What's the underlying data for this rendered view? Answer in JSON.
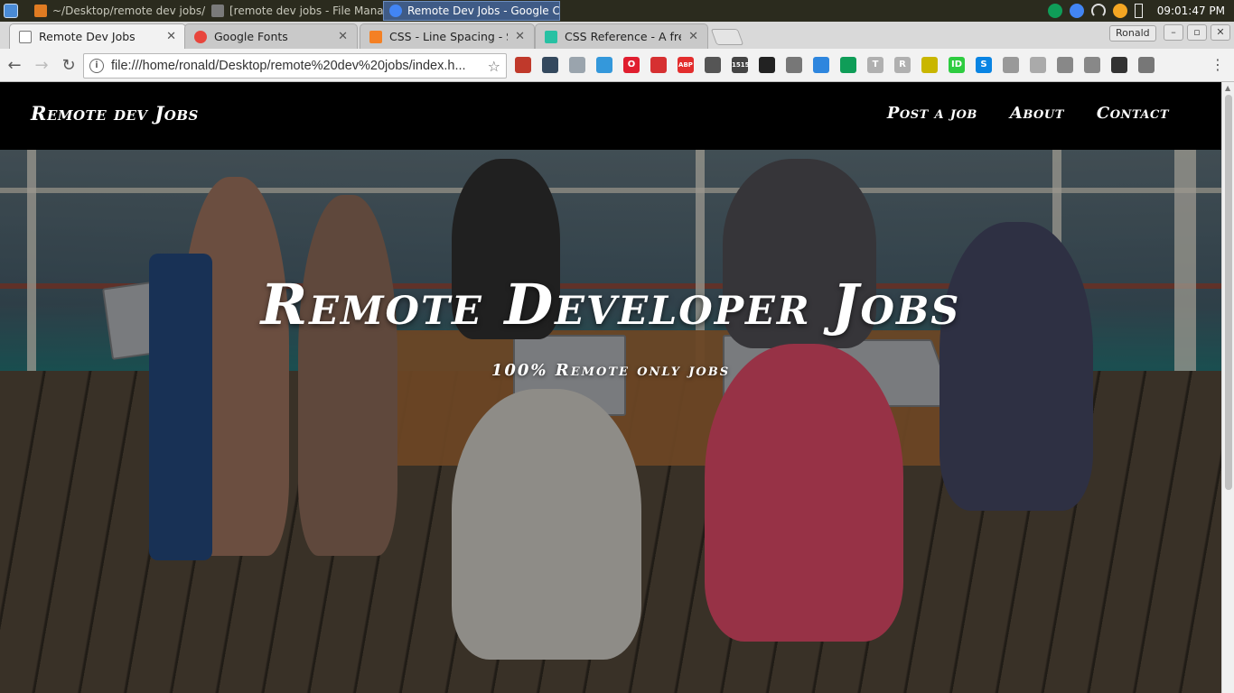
{
  "taskbar": {
    "tasks": [
      {
        "label": "~/Desktop/remote dev jobs/i...",
        "color": "#e07b22"
      },
      {
        "label": "[remote dev jobs - File Mana...",
        "color": "#7a7a7a"
      },
      {
        "label": "Remote Dev Jobs - Google C...",
        "color": "#4285f4"
      }
    ],
    "clock": "09:01:47 PM"
  },
  "browser": {
    "tabs": [
      {
        "title": "Remote Dev Jobs",
        "favicon": "document-icon",
        "color": "#777777"
      },
      {
        "title": "Google Fonts",
        "favicon": "google-fonts-icon",
        "color": "#e8453c"
      },
      {
        "title": "CSS - Line Spacing - Stac",
        "favicon": "stackoverflow-icon",
        "color": "#f48024"
      },
      {
        "title": "CSS Reference - A free v",
        "favicon": "codrops-icon",
        "color": "#27c1a3"
      }
    ],
    "profile": "Ronald",
    "url": "file:///home/ronald/Desktop/remote%20dev%20jobs/index.h...",
    "extensions": [
      {
        "name": "bookmark-icon",
        "color": "#c0392b",
        "text": ""
      },
      {
        "name": "cloud-icon",
        "color": "#34495e",
        "text": ""
      },
      {
        "name": "mail-icon",
        "color": "#9aa4ad",
        "text": ""
      },
      {
        "name": "download-icon",
        "color": "#3498db",
        "text": ""
      },
      {
        "name": "opera-icon",
        "color": "#e01e2f",
        "text": "O"
      },
      {
        "name": "stopwatch-icon",
        "color": "#d63031",
        "text": ""
      },
      {
        "name": "adblock-icon",
        "color": "#e32d2d",
        "text": "ABP"
      },
      {
        "name": "steering-icon",
        "color": "#555555",
        "text": ""
      },
      {
        "name": "days-counter-icon",
        "color": "#444444",
        "text": "1515"
      },
      {
        "name": "tampermonkey-icon",
        "color": "#222222",
        "text": ""
      },
      {
        "name": "paperclip-icon",
        "color": "#777777",
        "text": ""
      },
      {
        "name": "pulse-icon",
        "color": "#2e86de",
        "text": ""
      },
      {
        "name": "chat-icon",
        "color": "#0f9d58",
        "text": ""
      },
      {
        "name": "text-icon",
        "color": "#b0b0b0",
        "text": "T"
      },
      {
        "name": "readability-icon",
        "color": "#b0b0b0",
        "text": "R"
      },
      {
        "name": "light-icon",
        "color": "#c9b600",
        "text": ""
      },
      {
        "name": "id-icon",
        "color": "#2ecc40",
        "text": "ID"
      },
      {
        "name": "skype-icon",
        "color": "#0984e3",
        "text": "S"
      },
      {
        "name": "play-icon",
        "color": "#999999",
        "text": ""
      },
      {
        "name": "arrow-down-icon",
        "color": "#aaaaaa",
        "text": ""
      },
      {
        "name": "camera-icon",
        "color": "#888888",
        "text": ""
      },
      {
        "name": "layers-icon",
        "color": "#888888",
        "text": ""
      },
      {
        "name": "shield-icon",
        "color": "#333333",
        "text": ""
      },
      {
        "name": "globe-icon",
        "color": "#777777",
        "text": ""
      }
    ]
  },
  "site": {
    "brand": "Remote dev Jobs",
    "nav": [
      "Post a job",
      "About",
      "Contact"
    ],
    "hero_title": "Remote Developer Jobs",
    "hero_subtitle": "100% Remote only jobs"
  }
}
